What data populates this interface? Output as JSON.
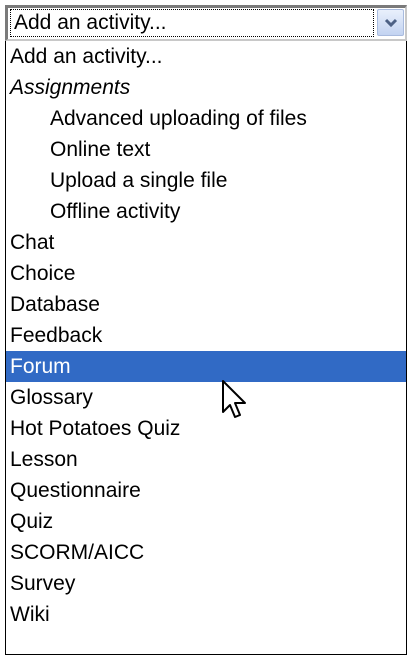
{
  "select": {
    "value": "Add an activity...",
    "arrow_icon": "chevron-down-icon"
  },
  "options": [
    {
      "label": "Add an activity...",
      "kind": "option"
    },
    {
      "label": "Assignments",
      "kind": "group"
    },
    {
      "label": "Advanced uploading of files",
      "kind": "indented"
    },
    {
      "label": "Online text",
      "kind": "indented"
    },
    {
      "label": "Upload a single file",
      "kind": "indented"
    },
    {
      "label": "Offline activity",
      "kind": "indented"
    },
    {
      "label": "Chat",
      "kind": "option"
    },
    {
      "label": "Choice",
      "kind": "option"
    },
    {
      "label": "Database",
      "kind": "option"
    },
    {
      "label": "Feedback",
      "kind": "option"
    },
    {
      "label": "Forum",
      "kind": "option",
      "highlighted": true
    },
    {
      "label": "Glossary",
      "kind": "option"
    },
    {
      "label": "Hot Potatoes Quiz",
      "kind": "option"
    },
    {
      "label": "Lesson",
      "kind": "option"
    },
    {
      "label": "Questionnaire",
      "kind": "option"
    },
    {
      "label": "Quiz",
      "kind": "option"
    },
    {
      "label": "SCORM/AICC",
      "kind": "option"
    },
    {
      "label": "Survey",
      "kind": "option"
    },
    {
      "label": "Wiki",
      "kind": "option"
    }
  ],
  "colors": {
    "highlight": "#316ac5",
    "highlight_text": "#ffffff"
  },
  "pointer_icon": "mouse-pointer-icon"
}
